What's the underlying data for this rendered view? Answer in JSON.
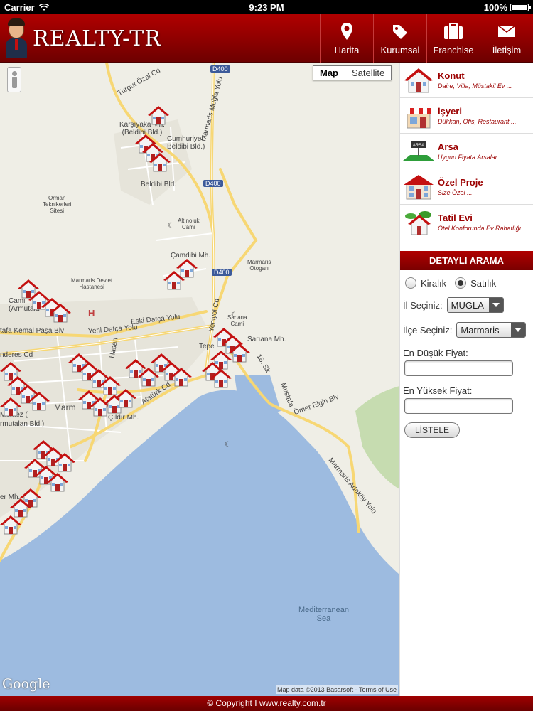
{
  "status": {
    "carrier": "Carrier",
    "time": "9:23 PM",
    "battery": "100%",
    "battery_level": 1.0
  },
  "brand": {
    "name": "REALTY-TR"
  },
  "nav": [
    {
      "label": "Harita",
      "icon": "map-pin-icon"
    },
    {
      "label": "Kurumsal",
      "icon": "tag-icon"
    },
    {
      "label": "Franchise",
      "icon": "briefcase-icon"
    },
    {
      "label": "İletişim",
      "icon": "envelope-icon"
    }
  ],
  "map": {
    "type_map": "Map",
    "type_satellite": "Satellite",
    "google": "Google",
    "attribution": "Map data ©2013 Basarsoft - ",
    "terms": "Terms of Use",
    "labels": {
      "karsiyaka": "Karşıyaka Mh.",
      "karsiyaka2": "(Beldibi Bld.)",
      "cumhuriyet": "Cumhuriyet",
      "cumhuriyet2": "Beldibi Bld.)",
      "beldibi": "Beldibi Bld.",
      "orman": "Orman",
      "orman2": "Teknikerleri",
      "orman3": "Sitesi",
      "altinoluk": "Altınoluk",
      "altinoluk2": "Cami",
      "camdibi": "Çamdibi Mh.",
      "otogar": "Marmaris",
      "otogar2": "Otogarı",
      "devlet": "Marmaris Devlet",
      "devlet2": "Hastanesi",
      "cami": "Cami",
      "armutalan": "(Armutala",
      "sariana_cami": "Sariana",
      "sariana_cami2": "Cami",
      "sariana": "Sarıana Mh.",
      "tepe": "Tepe",
      "cildir": "Çıldır Mh.",
      "marm": "Marm",
      "merkez": "Merkez (",
      "armutalan2": "rmutalan Bld.)",
      "mer": "er Mh.",
      "sea": "Mediterranean",
      "sea2": "Sea",
      "d400a": "D400",
      "d400b": "D400",
      "d400c": "D400"
    },
    "roads": {
      "turgut": "Turgut Özal Cd",
      "mugla": "Marmaris Muğla Yolu",
      "yenidatca": "Yeni Datça Yolu",
      "eskidatca": "Eski Datça Yolu",
      "kemalpasa": "tafa Kemal Paşa Blv",
      "enderes": "nderes Cd",
      "ataturk": "Atatürk Cd",
      "yeniyol": "Yeniyol Cd",
      "hasan": "Hasan",
      "sk18": "18. Sk",
      "mustafa": "Mustafa",
      "elgin": "Ömer Elgin Blv",
      "adakoy": "Marmaris Adaköy Yolu"
    }
  },
  "categories": [
    {
      "title": "Konut",
      "subtitle": "Daire, Villa, Müstakil Ev ...",
      "icon": "house-icon"
    },
    {
      "title": "İşyeri",
      "subtitle": "Dükkan, Ofis, Restaurant ...",
      "icon": "shop-icon"
    },
    {
      "title": "Arsa",
      "subtitle": "Uygun Fiyata Arsalar ...",
      "icon": "land-icon",
      "sign": "ARSA"
    },
    {
      "title": "Özel Proje",
      "subtitle": "Size Özel ...",
      "icon": "project-icon"
    },
    {
      "title": "Tatil Evi",
      "subtitle": "Otel Konforunda Ev Rahatlığı",
      "icon": "holiday-house-icon"
    }
  ],
  "search": {
    "title": "DETAYLI ARAMA",
    "rent_label": "Kiralık",
    "sale_label": "Satılık",
    "selected": "Satılık",
    "province_label": "İl Seçiniz:",
    "province_value": "MUĞLA",
    "district_label": "İlçe Seçiniz:",
    "district_value": "Marmaris",
    "min_label": "En Düşük Fiyat:",
    "min_value": "",
    "max_label": "En Yüksek Fiyat:",
    "max_value": "",
    "button": "LİSTELE"
  },
  "footer": "© Copyright I www.realty.com.tr",
  "colors": {
    "brand_red": "#9b0000",
    "sea": "#9dbbe0",
    "land": "#efeee6",
    "road": "#fde38a"
  }
}
